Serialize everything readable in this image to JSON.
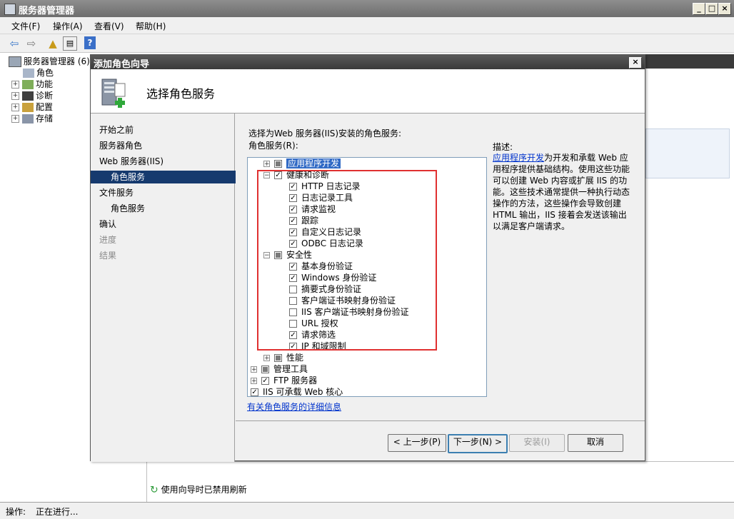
{
  "window": {
    "title": "服务器管理器"
  },
  "menu": [
    "文件(F)",
    "操作(A)",
    "查看(V)",
    "帮助(H)"
  ],
  "toolbar": {
    "icons": [
      "back-arrow-icon",
      "forward-arrow-icon",
      "up-folder-icon",
      "show-hide-tree-icon",
      "help-icon"
    ],
    "help_glyph": "?"
  },
  "tree": {
    "root": "服务器管理器",
    "root_suffix": "(6)",
    "items": [
      "角色",
      "功能",
      "诊断",
      "配置",
      "存储"
    ]
  },
  "dialog": {
    "title": "添加角色向导",
    "header": "选择角色服务",
    "steps": [
      "开始之前",
      "服务器角色",
      "Web 服务器(IIS)",
      "角色服务",
      "文件服务",
      "角色服务",
      "确认",
      "进度",
      "结果"
    ],
    "instruction": "选择为Web 服务器(IIS)安装的角色服务:",
    "list_label": "角色服务(R):",
    "desc_title": "描述:",
    "desc_link": "应用程序开发",
    "desc_text": "为开发和承载 Web 应用程序提供基础结构。使用这些功能可以创建 Web 内容或扩展 IIS 的功能。这些技术通常提供一种执行动态操作的方法，这些操作会导致创建 HTML 输出，IIS 接着会发送该输出以满足客户端请求。",
    "more_link": "有关角色服务的详细信息",
    "buttons": {
      "back": "< 上一步(P)",
      "next": "下一步(N) >",
      "install": "安装(I)",
      "cancel": "取消"
    }
  },
  "role_services": [
    {
      "label": "应用程序开发",
      "state": "indeterminate",
      "expander": "+",
      "level": 1
    },
    {
      "label": "健康和诊断",
      "state": "checked",
      "expander": "-",
      "level": 1
    },
    {
      "label": "HTTP 日志记录",
      "state": "checked",
      "level": 2
    },
    {
      "label": "日志记录工具",
      "state": "checked",
      "level": 2
    },
    {
      "label": "请求监视",
      "state": "checked",
      "level": 2
    },
    {
      "label": "跟踪",
      "state": "checked",
      "level": 2
    },
    {
      "label": "自定义日志记录",
      "state": "checked",
      "level": 2
    },
    {
      "label": "ODBC 日志记录",
      "state": "checked",
      "level": 2
    },
    {
      "label": "安全性",
      "state": "indeterminate",
      "expander": "-",
      "level": 1
    },
    {
      "label": "基本身份验证",
      "state": "checked",
      "level": 2
    },
    {
      "label": "Windows 身份验证",
      "state": "checked",
      "level": 2
    },
    {
      "label": "摘要式身份验证",
      "state": "unchecked",
      "level": 2
    },
    {
      "label": "客户端证书映射身份验证",
      "state": "unchecked",
      "level": 2
    },
    {
      "label": "IIS 客户端证书映射身份验证",
      "state": "unchecked",
      "level": 2
    },
    {
      "label": "URL 授权",
      "state": "unchecked",
      "level": 2
    },
    {
      "label": "请求筛选",
      "state": "checked",
      "level": 2
    },
    {
      "label": "IP 和域限制",
      "state": "checked",
      "level": 2
    },
    {
      "label": "性能",
      "state": "indeterminate",
      "expander": "+",
      "level": 1
    },
    {
      "label": "管理工具",
      "state": "indeterminate",
      "expander": "+",
      "level": 0
    },
    {
      "label": "FTP 服务器",
      "state": "checked",
      "expander": "+",
      "level": 0
    },
    {
      "label": "IIS 可承载 Web 核心",
      "state": "checked",
      "level": 0
    }
  ],
  "bottom": {
    "refresh_notice": "使用向导时已禁用刷新"
  },
  "status": {
    "label": "操作:",
    "text": "正在进行..."
  },
  "colors": {
    "highlight_box": "#e03030",
    "selection": "#316ac5",
    "link": "#0033cc"
  }
}
